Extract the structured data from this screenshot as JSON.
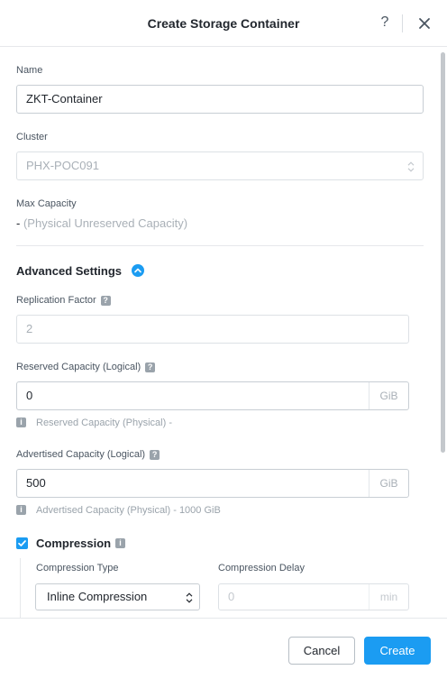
{
  "dialog": {
    "title": "Create Storage Container",
    "help_symbol": "?"
  },
  "form": {
    "name": {
      "label": "Name",
      "value": "ZKT-Container"
    },
    "cluster": {
      "label": "Cluster",
      "value": "PHX-POC091"
    },
    "max_capacity": {
      "label": "Max Capacity",
      "value": "-",
      "note": "(Physical Unreserved Capacity)"
    }
  },
  "advanced": {
    "title": "Advanced Settings",
    "replication_factor": {
      "label": "Replication Factor",
      "value": "2"
    },
    "reserved_capacity": {
      "label": "Reserved Capacity (Logical)",
      "value": "0",
      "unit": "GiB",
      "info": "Reserved Capacity (Physical) -"
    },
    "advertised_capacity": {
      "label": "Advertised Capacity (Logical)",
      "value": "500",
      "unit": "GiB",
      "info": "Advertised Capacity (Physical) - 1000 GiB"
    },
    "compression": {
      "label": "Compression",
      "checked": true,
      "type_label": "Compression Type",
      "type_value": "Inline Compression",
      "delay_label": "Compression Delay",
      "delay_placeholder": "0",
      "delay_unit": "min"
    }
  },
  "footer": {
    "cancel_label": "Cancel",
    "create_label": "Create"
  },
  "colors": {
    "accent": "#1b9cf2",
    "text": "#22272e",
    "muted": "#9aa3ab"
  }
}
